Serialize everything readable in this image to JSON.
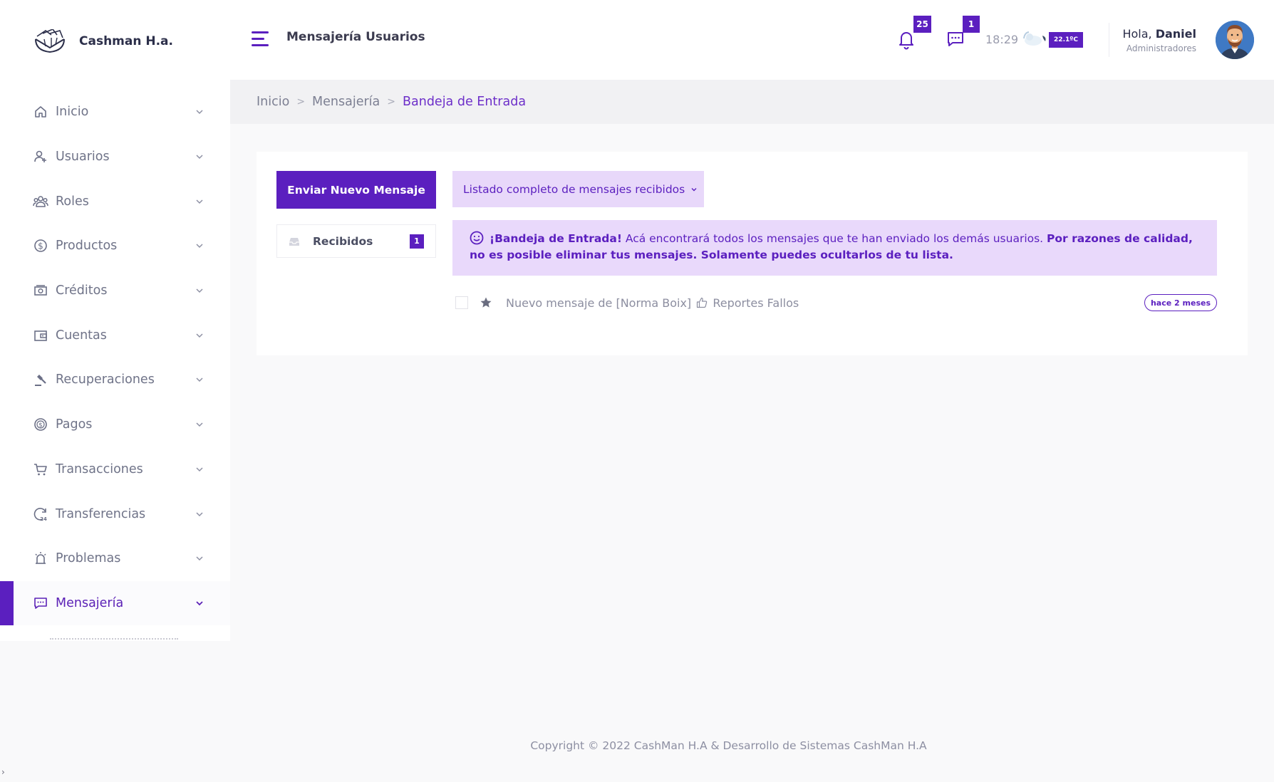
{
  "brand": {
    "name": "Cashman H.a."
  },
  "sidebar": {
    "items": [
      {
        "label": "Inicio",
        "icon": "home-icon"
      },
      {
        "label": "Usuarios",
        "icon": "user-plus-icon"
      },
      {
        "label": "Roles",
        "icon": "users-group-icon"
      },
      {
        "label": "Productos",
        "icon": "dollar-circle-icon"
      },
      {
        "label": "Créditos",
        "icon": "money-icon"
      },
      {
        "label": "Cuentas",
        "icon": "wallet-icon"
      },
      {
        "label": "Recuperaciones",
        "icon": "gavel-icon"
      },
      {
        "label": "Pagos",
        "icon": "coins-icon"
      },
      {
        "label": "Transacciones",
        "icon": "cart-icon"
      },
      {
        "label": "Transferencias",
        "icon": "refresh-24-icon"
      },
      {
        "label": "Problemas",
        "icon": "alarm-icon"
      },
      {
        "label": "Mensajería",
        "icon": "message-icon",
        "active": true
      }
    ]
  },
  "header": {
    "title": "Mensajería Usuarios",
    "notifications_count": "25",
    "messages_count": "1",
    "time": "18:29",
    "temperature": "22.1ºC",
    "greeting_prefix": "Hola,",
    "user_name": "Daniel",
    "user_role": "Administradores"
  },
  "breadcrumb": {
    "items": [
      "Inicio",
      "Mensajería"
    ],
    "current": "Bandeja de Entrada",
    "separator": ">"
  },
  "inbox": {
    "new_message_label": "Enviar Nuevo Mensaje",
    "folder_label": "Recibidos",
    "folder_count": "1",
    "filter_label": "Listado completo de mensajes recibidos",
    "alert_title": "¡Bandeja de Entrada!",
    "alert_text": "Acá encontrará todos los mensajes que te han enviado los demás usuarios.",
    "alert_strong": "Por razones de calidad, no es posible eliminar tus mensajes. Solamente puedes ocultarlos de tu lista.",
    "messages": [
      {
        "prefix": "Nuevo mensaje de [Norma Boix]",
        "subject": "Reportes Fallos",
        "time": "hace 2 meses"
      }
    ]
  },
  "footer": {
    "copyright": "Copyright © 2022 CashMan H.A & Desarrollo de Sistemas CashMan H.A"
  },
  "colors": {
    "accent": "#5b1fbf",
    "accent_light": "#e9d9fb",
    "sidebar_bg": "#ffffff",
    "page_bg": "#f9f9fa"
  }
}
